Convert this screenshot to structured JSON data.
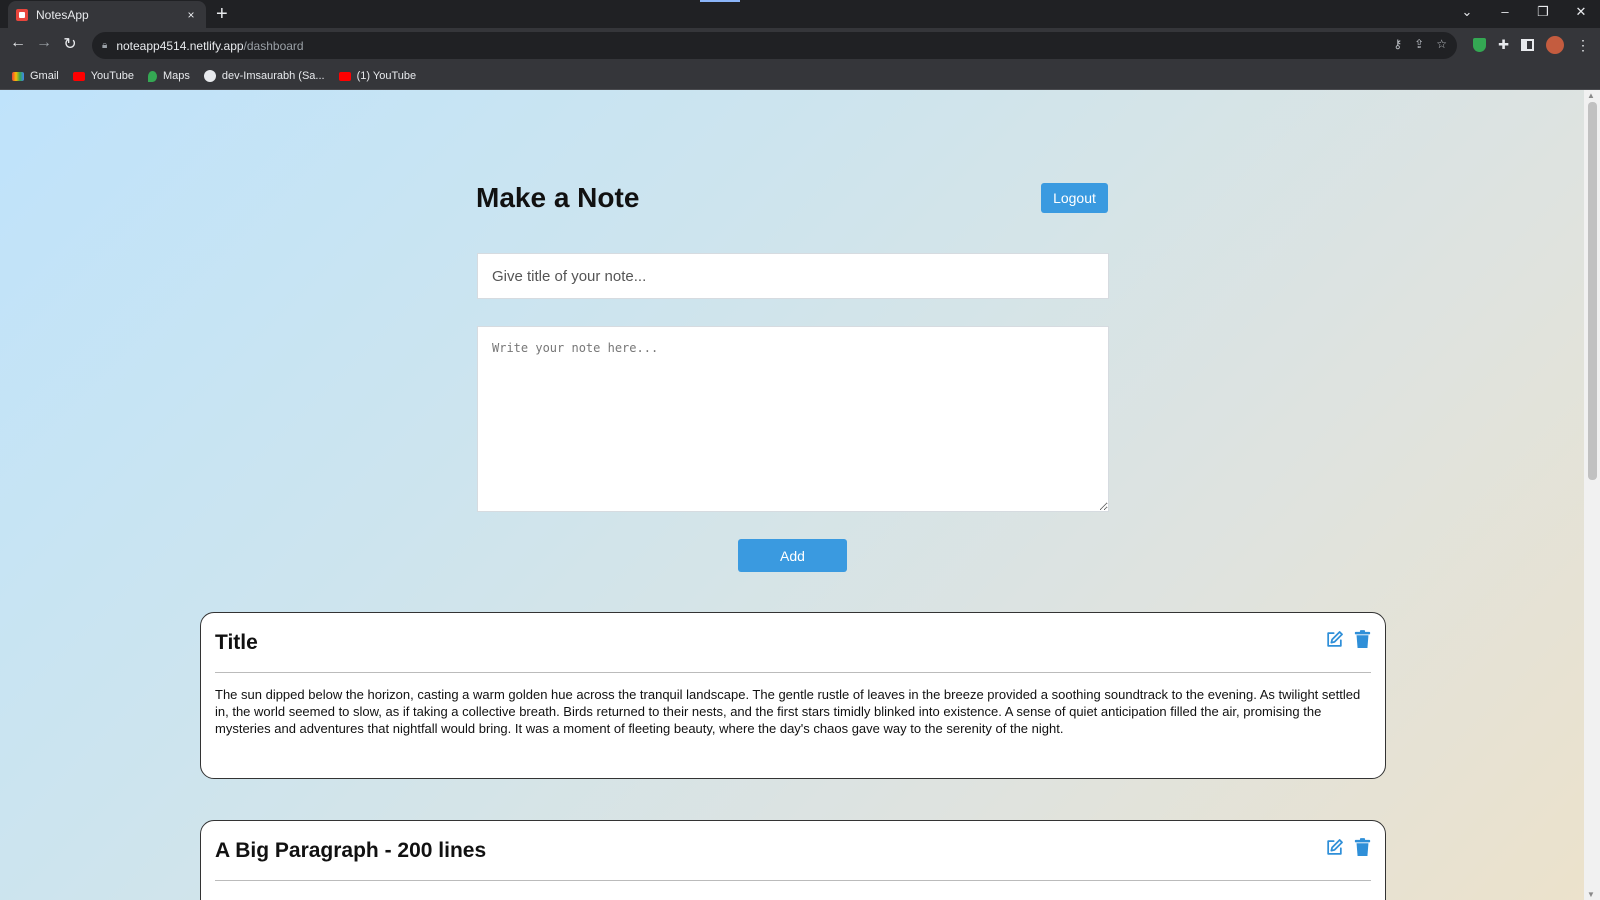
{
  "browser": {
    "tab_title": "NotesApp",
    "tab_close": "×",
    "new_tab": "+",
    "url_host": "noteapp4514.netlify.app",
    "url_path": "/dashboard",
    "bookmarks": [
      {
        "label": "Gmail",
        "icon": "gmail-icon"
      },
      {
        "label": "YouTube",
        "icon": "youtube-icon"
      },
      {
        "label": "Maps",
        "icon": "maps-icon"
      },
      {
        "label": "dev-Imsaurabh (Sa...",
        "icon": "github-icon"
      },
      {
        "label": "(1) YouTube",
        "icon": "youtube-icon"
      }
    ]
  },
  "page": {
    "title": "Make a Note",
    "logout_label": "Logout",
    "title_placeholder": "Give title of your note...",
    "note_placeholder": "Write your note here...",
    "add_label": "Add"
  },
  "notes": [
    {
      "title": "Title",
      "body": "The sun dipped below the horizon, casting a warm golden hue across the tranquil landscape. The gentle rustle of leaves in the breeze provided a soothing soundtrack to the evening. As twilight settled in, the world seemed to slow, as if taking a collective breath. Birds returned to their nests, and the first stars timidly blinked into existence. A sense of quiet anticipation filled the air, promising the mysteries and adventures that nightfall would bring. It was a moment of fleeting beauty, where the day's chaos gave way to the serenity of the night."
    },
    {
      "title": "A Big Paragraph - 200 lines",
      "body": ""
    }
  ],
  "colors": {
    "accent": "#3a9ae0",
    "icon_blue": "#2f8fd8"
  }
}
